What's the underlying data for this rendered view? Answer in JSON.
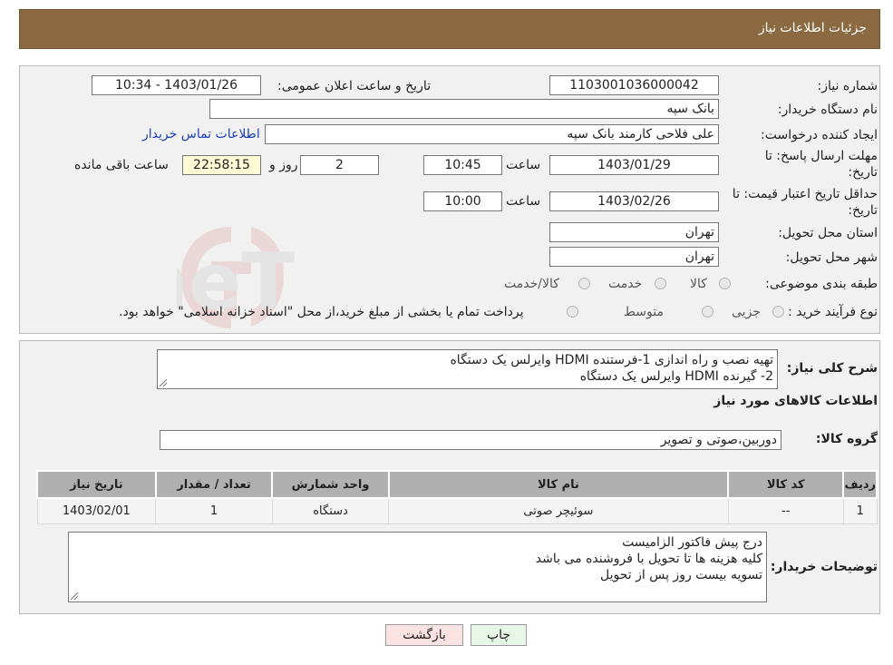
{
  "header": {
    "title": "جزئیات اطلاعات نیاز"
  },
  "watermark": {
    "text": "AriaTender.neT"
  },
  "form": {
    "need_number_label": "شماره نیاز:",
    "need_number": "1103001036000042",
    "announce_label": "تاریخ و ساعت اعلان عمومی:",
    "announce_value": "1403/01/26 - 10:34",
    "buyer_org_label": "نام دستگاه خریدار:",
    "buyer_org": "بانک سپه",
    "creator_label": "ایجاد کننده درخواست:",
    "creator": "علی فلاحی کارمند بانک سپه",
    "contact_link": "اطلاعات تماس خریدار",
    "deadline_label_1": "مهلت ارسال پاسخ: تا",
    "deadline_label_2": "تاریخ:",
    "deadline_date": "1403/01/29",
    "time_label": "ساعت",
    "deadline_time": "10:45",
    "days_value": "2",
    "days_label": "روز و",
    "remaining_time": "22:58:15",
    "remaining_label": "ساعت باقی مانده",
    "validity_label_1": "حداقل تاریخ اعتبار قیمت: تا",
    "validity_label_2": "تاریخ:",
    "validity_date": "1403/02/26",
    "validity_time_label": "ساعت",
    "validity_time": "10:00",
    "province_label": "استان محل تحویل:",
    "province": "تهران",
    "city_label": "شهر محل تحویل:",
    "city": "تهران",
    "category_label": "طبقه بندی موضوعی:",
    "category_options": [
      "کالا",
      "خدمت",
      "کالا/خدمت"
    ],
    "process_label": "نوع فرآیند خرید :",
    "process_options": [
      "جزیی",
      "متوسط"
    ],
    "payment_note": "پرداخت تمام یا بخشی از مبلغ خرید،از محل \"اسناد خزانه اسلامی\" خواهد بود."
  },
  "description": {
    "label": "شرح کلی نیاز:",
    "lines": [
      "تهیه نصب و راه اندازی 1-فرستنده HDMI وایرلس یک دستگاه",
      "2- گیرنده HDMI وایرلس یک دستگاه"
    ]
  },
  "goods": {
    "section_title": "اطلاعات کالاهای مورد نیاز",
    "group_label": "گروه کالا:",
    "group_value": "دوربین،صوتی و تصویر",
    "columns": [
      "ردیف",
      "کد کالا",
      "نام کالا",
      "واحد شمارش",
      "تعداد / مقدار",
      "تاریخ نیاز"
    ],
    "rows": [
      [
        "1",
        "--",
        "سوئیچر صوتی",
        "دستگاه",
        "1",
        "1403/02/01"
      ]
    ]
  },
  "buyer_notes": {
    "label": "توضیحات خریدار:",
    "lines": [
      "درج پیش فاکتور الزامیست",
      "کلیه هزینه ها تا تحویل با فروشنده می باشد",
      "تسویه بیست روز پس از تحویل"
    ]
  },
  "buttons": {
    "print": "چاپ",
    "back": "بازگشت"
  },
  "colors": {
    "header_bg": "#8b6a42",
    "print_bg": "#e9f7e9",
    "back_bg": "#fbe3e3",
    "link": "#1a3fb5",
    "remaining_bg": "#fffbd4"
  }
}
